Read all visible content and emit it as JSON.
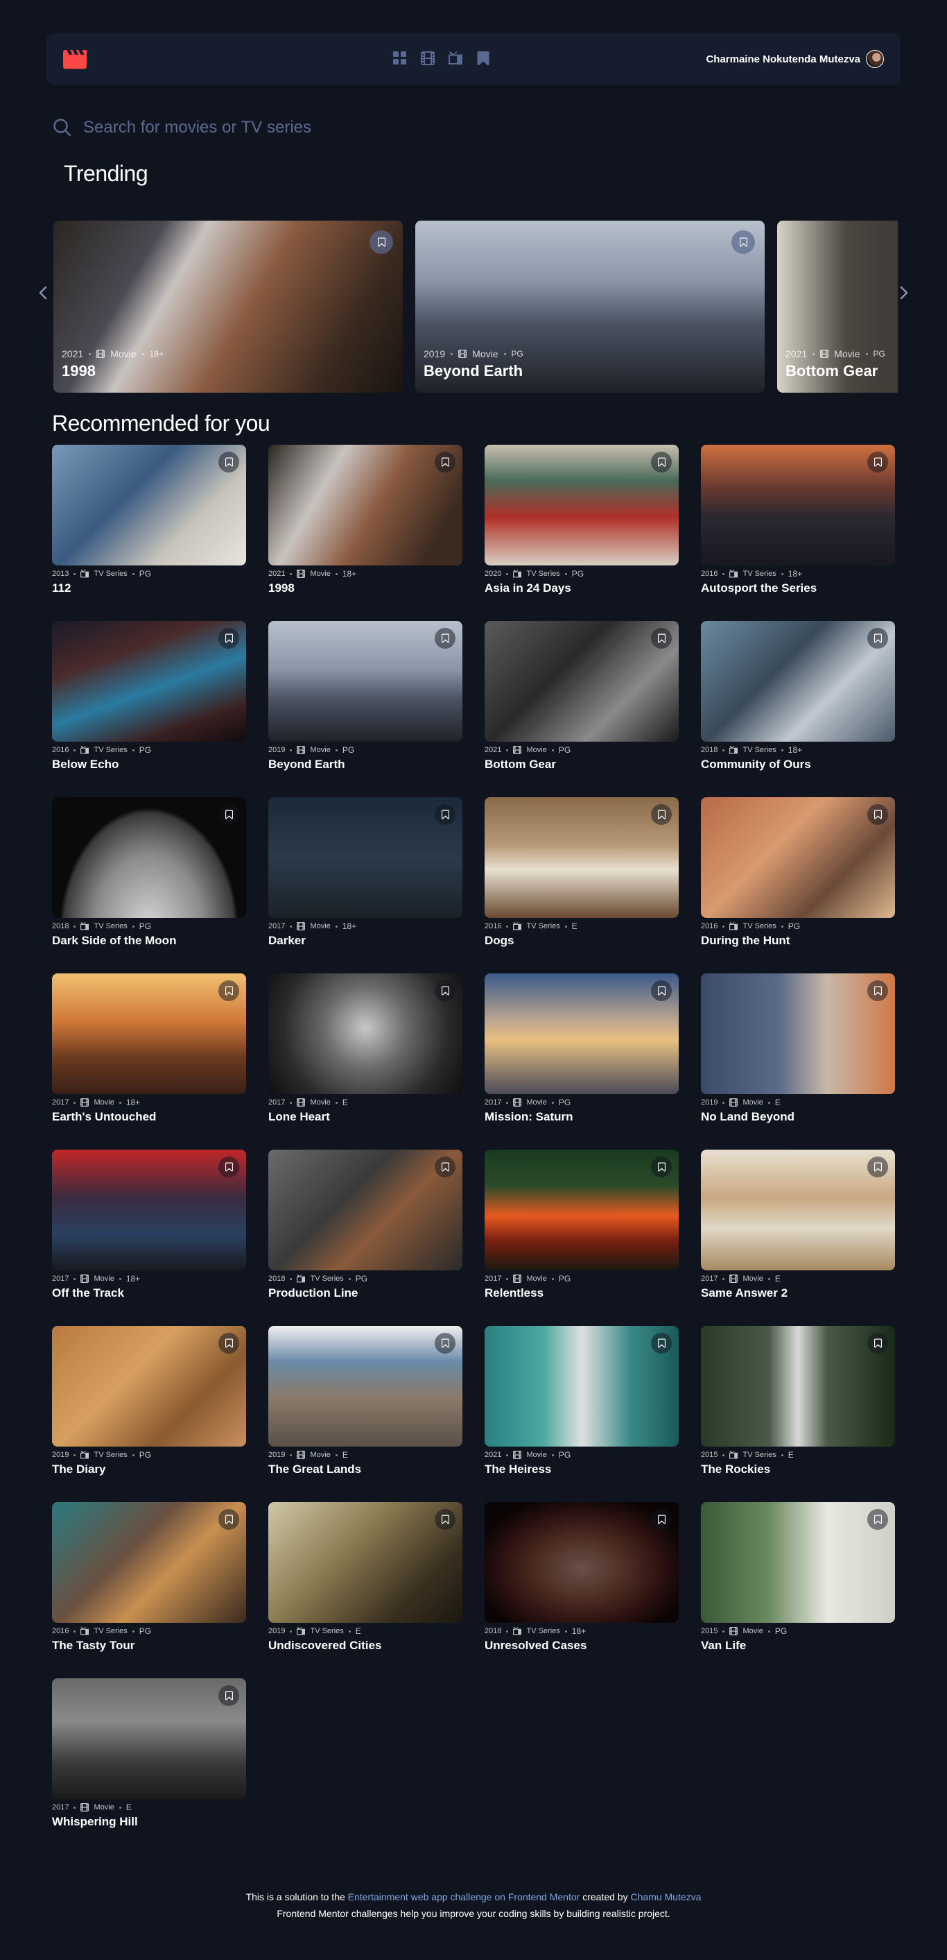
{
  "nav": {
    "user_name": "Charmaine Nokutenda Mutezva"
  },
  "search": {
    "placeholder": "Search for movies or TV series"
  },
  "sections": {
    "trending": "Trending",
    "recommended": "Recommended for you"
  },
  "trending": [
    {
      "year": "2021",
      "category": "Movie",
      "rating": "18+",
      "title": "1998",
      "bg": "linear-gradient(120deg,#2a2622 0%,#4a4a52 25%,#c9c3c0 35%,#8a5a40 55%,#3a2a20 80%,#1a1410 100%)"
    },
    {
      "year": "2019",
      "category": "Movie",
      "rating": "PG",
      "title": "Beyond Earth",
      "bg": "linear-gradient(180deg,#b8c0cc 0%,#8a96a8 35%,#4a5262 60%,#1e2228 100%)"
    },
    {
      "year": "2021",
      "category": "Movie",
      "rating": "PG",
      "title": "Bottom Gear",
      "bg": "linear-gradient(90deg,#d8d4c8 0%,#4a4640 20%,#2a2826 60%,#1a1918 100%)"
    }
  ],
  "recommended": [
    {
      "year": "2013",
      "category": "TV Series",
      "rating": "PG",
      "title": "112",
      "bg": "linear-gradient(135deg,#7a9ab8 0%,#3a5a80 40%,#c8c4bc 70%,#e8e4de 100%)"
    },
    {
      "year": "2021",
      "category": "Movie",
      "rating": "18+",
      "title": "1998",
      "bg": "linear-gradient(120deg,#2a2622 0%,#c9c3c0 30%,#8a5a40 55%,#3a2a20 85%)"
    },
    {
      "year": "2020",
      "category": "TV Series",
      "rating": "PG",
      "title": "Asia in 24 Days",
      "bg": "linear-gradient(180deg,#c8c0b0 0%,#4a6a58 30%,#b03028 60%,#d8cfc2 100%)"
    },
    {
      "year": "2016",
      "category": "TV Series",
      "rating": "18+",
      "title": "Autosport the Series",
      "bg": "linear-gradient(180deg,#d07040 0%,#6a3a30 35%,#2a2830 60%,#181820 100%)"
    },
    {
      "year": "2016",
      "category": "TV Series",
      "rating": "PG",
      "title": "Below Echo",
      "bg": "linear-gradient(160deg,#1a1a28 0%,#4a2a2a 30%,#2a7aa0 55%,#3a2020 80%,#100c10 100%)"
    },
    {
      "year": "2019",
      "category": "Movie",
      "rating": "PG",
      "title": "Beyond Earth",
      "bg": "linear-gradient(180deg,#b8c0cc 0%,#8a96a8 40%,#4a5262 65%,#1e2228 100%)"
    },
    {
      "year": "2021",
      "category": "Movie",
      "rating": "PG",
      "title": "Bottom Gear",
      "bg": "linear-gradient(135deg,#5a5a5a 0%,#2a2a2a 40%,#8a8a8a 70%,#1a1a1a 100%)"
    },
    {
      "year": "2018",
      "category": "TV Series",
      "rating": "18+",
      "title": "Community of Ours",
      "bg": "linear-gradient(135deg,#6a8aa0 0%,#3a4a5a 40%,#c0c8d0 65%,#4a5a6a 100%)"
    },
    {
      "year": "2018",
      "category": "TV Series",
      "rating": "PG",
      "title": "Dark Side of the Moon",
      "bg": "radial-gradient(ellipse at 50% 110%,#d8d8d8 0%,#8a8a8a 40%,#3a3a3a 62%,#0a0a0a 65%)"
    },
    {
      "year": "2017",
      "category": "Movie",
      "rating": "18+",
      "title": "Darker",
      "bg": "linear-gradient(180deg,#1a2a3a 0%,#2a3a4a 50%,#1a2228 100%)"
    },
    {
      "year": "2016",
      "category": "TV Series",
      "rating": "E",
      "title": "Dogs",
      "bg": "linear-gradient(180deg,#8a6a48 0%,#b89a78 40%,#e8e0d0 60%,#6a4a30 100%)"
    },
    {
      "year": "2016",
      "category": "TV Series",
      "rating": "PG",
      "title": "During the Hunt",
      "bg": "linear-gradient(135deg,#b86a48 0%,#d89a70 40%,#6a4a38 70%,#e0b890 100%)"
    },
    {
      "year": "2017",
      "category": "Movie",
      "rating": "18+",
      "title": "Earth's Untouched",
      "bg": "linear-gradient(180deg,#f0c070 0%,#d07838 40%,#6a3a20 70%,#3a2018 100%)"
    },
    {
      "year": "2017",
      "category": "Movie",
      "rating": "E",
      "title": "Lone Heart",
      "bg": "radial-gradient(circle at 50% 45%,#c8c8c8 0%,#6a6a6a 35%,#2a2a2a 70%,#0e0e0e 100%)"
    },
    {
      "year": "2017",
      "category": "Movie",
      "rating": "PG",
      "title": "Mission: Saturn",
      "bg": "linear-gradient(180deg,#3a5a8a 0%,#c0a890 40%,#e8c080 55%,#4a4a58 100%)"
    },
    {
      "year": "2019",
      "category": "Movie",
      "rating": "E",
      "title": "No Land Beyond",
      "bg": "linear-gradient(90deg,#3a4a68 0%,#5a6a8a 40%,#c8b8a8 65%,#d07848 100%)"
    },
    {
      "year": "2017",
      "category": "Movie",
      "rating": "18+",
      "title": "Off the Track",
      "bg": "linear-gradient(180deg,#c02828 0%,#3a2a40 40%,#2a4060 70%,#1a1a20 100%)"
    },
    {
      "year": "2018",
      "category": "TV Series",
      "rating": "PG",
      "title": "Production Line",
      "bg": "linear-gradient(135deg,#6a6a6a 0%,#3a3a3a 40%,#8a5a3a 60%,#2a2a2a 100%)"
    },
    {
      "year": "2017",
      "category": "Movie",
      "rating": "PG",
      "title": "Relentless",
      "bg": "linear-gradient(180deg,#1a3a20 0%,#2a4a28 30%,#e85a20 55%,#7a2010 75%,#1a1a10 100%)"
    },
    {
      "year": "2017",
      "category": "Movie",
      "rating": "E",
      "title": "Same Answer 2",
      "bg": "linear-gradient(180deg,#e8e0d0 0%,#c8a880 40%,#e0d8c8 65%,#a88a60 100%)"
    },
    {
      "year": "2019",
      "category": "TV Series",
      "rating": "PG",
      "title": "The Diary",
      "bg": "linear-gradient(135deg,#b87a40 0%,#d8a060 40%,#8a5a30 70%,#c89060 100%)"
    },
    {
      "year": "2019",
      "category": "Movie",
      "rating": "E",
      "title": "The Great Lands",
      "bg": "linear-gradient(180deg,#f0f0f0 0%,#6a8aa8 30%,#8a7a68 60%,#5a5048 100%)"
    },
    {
      "year": "2021",
      "category": "Movie",
      "rating": "PG",
      "title": "The Heiress",
      "bg": "linear-gradient(90deg,#2a8080 0%,#4aa8a0 30%,#e0e0e0 50%,#3a8a88 75%,#1a5a58 100%)"
    },
    {
      "year": "2015",
      "category": "TV Series",
      "rating": "E",
      "title": "The Rockies",
      "bg": "linear-gradient(90deg,#2a3a28 0%,#4a5a48 35%,#d8d8d8 50%,#4a5a48 65%,#1a2a18 100%)"
    },
    {
      "year": "2016",
      "category": "TV Series",
      "rating": "PG",
      "title": "The Tasty Tour",
      "bg": "linear-gradient(135deg,#2a7a80 0%,#6a5040 40%,#c89050 60%,#3a2a20 100%)"
    },
    {
      "year": "2019",
      "category": "TV Series",
      "rating": "E",
      "title": "Undiscovered Cities",
      "bg": "linear-gradient(135deg,#d0c8a8 0%,#8a7a50 40%,#3a3020 75%,#1a1810 100%)"
    },
    {
      "year": "2018",
      "category": "TV Series",
      "rating": "18+",
      "title": "Unresolved Cases",
      "bg": "radial-gradient(ellipse at 50% 55%,#6a5048 0%,#4a2a20 35%,#2a1010 60%,#0a0404 80%)"
    },
    {
      "year": "2015",
      "category": "Movie",
      "rating": "PG",
      "title": "Van Life",
      "bg": "linear-gradient(90deg,#3a5a38 0%,#6a8a60 35%,#e8e8e0 65%,#d0d0c8 100%)"
    },
    {
      "year": "2017",
      "category": "Movie",
      "rating": "E",
      "title": "Whispering Hill",
      "bg": "linear-gradient(180deg,#6a6a6a 0%,#8a8a8a 35%,#3a3a3a 70%,#1a1a1a 100%)"
    }
  ],
  "footer": {
    "line1_prefix": "This is a solution to the ",
    "challenge_link": "Entertainment web app challenge on Frontend Mentor",
    "created_by": " created by ",
    "author_link": "Chamu Mutezva",
    "line2": "Frontend Mentor challenges help you improve your coding skills by building realistic project."
  },
  "colors": {
    "background": "#10141e",
    "surface": "#161d2f",
    "accent": "#fc4747",
    "muted": "#5a698f"
  }
}
